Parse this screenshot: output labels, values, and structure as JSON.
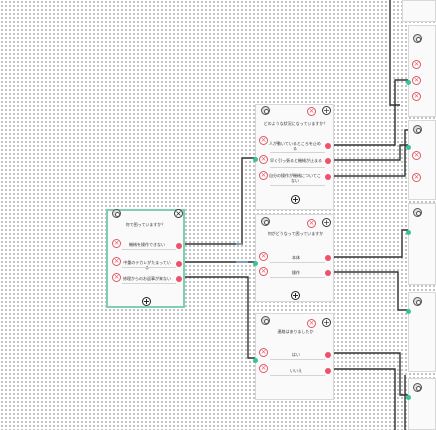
{
  "icons": {
    "settings": "gear-icon",
    "delete": "close-icon",
    "add": "plus-icon",
    "option_delete": "x-circle-icon"
  },
  "colors": {
    "output_port": "#f0506a",
    "input_port": "#39c39a",
    "selected_border": "#7fcfb2",
    "wire": "#333333"
  },
  "nodes": {
    "root": {
      "title": "何で困っていますか？",
      "options": [
        "機械を操作できない",
        "中重のテカレがたまっている",
        "修理からのお返事が来ない"
      ]
    },
    "machine": {
      "title": "どのような状況になっていますか？",
      "options": [
        "人が動いているところを止める",
        "早く引っ張ると機械が止まる",
        "自分の操作が機械についてこない"
      ]
    },
    "dust": {
      "title": "何がどうなって困っていますか",
      "options": [
        "本体",
        "操作"
      ]
    },
    "reply": {
      "title": "連絡はありましたか",
      "options": [
        "はい",
        "いいえ"
      ]
    }
  }
}
